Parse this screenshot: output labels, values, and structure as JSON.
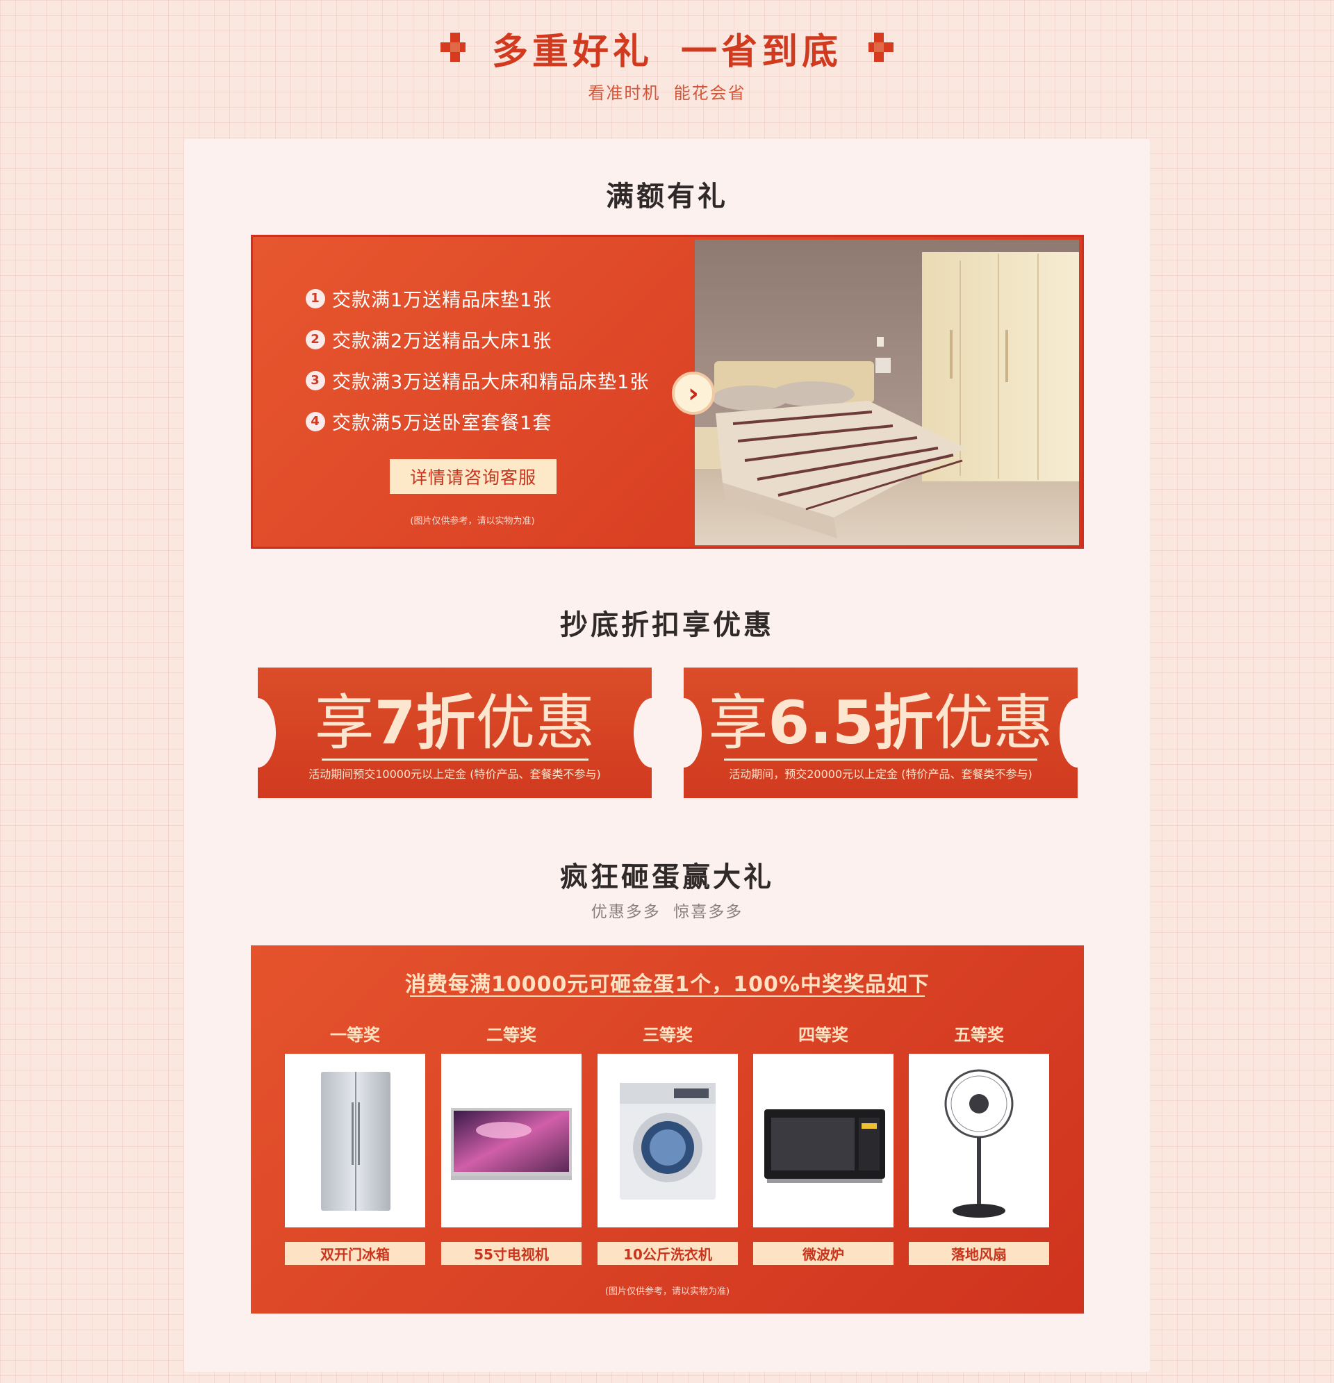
{
  "header": {
    "title_left": "多重好礼",
    "title_right": "一省到底",
    "subtitle": "看准时机  能花会省"
  },
  "section_gift": {
    "title": "满额有礼",
    "offers": [
      {
        "num": "1",
        "text": "交款满1万送精品床垫1张"
      },
      {
        "num": "2",
        "text": "交款满2万送精品大床1张"
      },
      {
        "num": "3",
        "text": "交款满3万送精品大床和精品床垫1张"
      },
      {
        "num": "4",
        "text": "交款满5万送卧室套餐1套"
      }
    ],
    "button_label": "详情请咨询客服",
    "note": "(图片仅供参考，请以实物为准)",
    "arrow_icon": "chevron-right-icon"
  },
  "section_discount": {
    "title": "抄底折扣享优惠",
    "tickets": [
      {
        "prefix": "享",
        "value": "7折",
        "suffix": "优惠",
        "note": "活动期间预交10000元以上定金 (特价产品、套餐类不参与)"
      },
      {
        "prefix": "享",
        "value": "6.5折",
        "suffix": "优惠",
        "note": "活动期间，预交20000元以上定金 (特价产品、套餐类不参与)"
      }
    ]
  },
  "section_egg": {
    "title": "疯狂砸蛋赢大礼",
    "subtitle": "优惠多多  惊喜多多",
    "headline": "消费每满10000元可砸金蛋1个，100%中奖奖品如下",
    "prizes": [
      {
        "rank": "一等奖",
        "name": "双开门冰箱",
        "icon": "refrigerator-icon"
      },
      {
        "rank": "二等奖",
        "name": "55寸电视机",
        "icon": "tv-icon"
      },
      {
        "rank": "三等奖",
        "name": "10公斤洗衣机",
        "icon": "washing-machine-icon"
      },
      {
        "rank": "四等奖",
        "name": "微波炉",
        "icon": "microwave-icon"
      },
      {
        "rank": "五等奖",
        "name": "落地风扇",
        "icon": "fan-icon"
      }
    ],
    "note": "(图片仅供参考，请以实物为准)"
  },
  "colors": {
    "accent": "#d23a20",
    "card": "#dd4526",
    "cream": "#fde3c3",
    "background": "#f9e7e0",
    "panel": "#fcf1ee"
  }
}
